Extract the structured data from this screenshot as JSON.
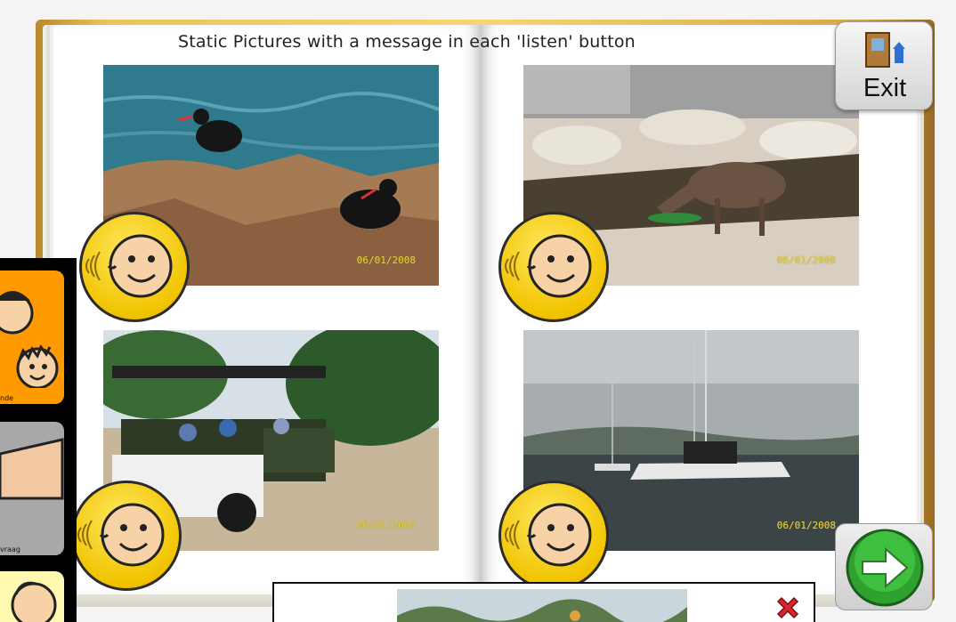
{
  "page": {
    "title": "Static Pictures with a message in each 'listen' button"
  },
  "photos": [
    {
      "name": "oystercatchers",
      "date": "06/01/2008"
    },
    {
      "name": "antelope",
      "date": "06/01/2008"
    },
    {
      "name": "safari-vehicle",
      "date": "06/01/2008"
    },
    {
      "name": "catamaran",
      "date": "06/01/2008"
    }
  ],
  "controls": {
    "exit_label": "Exit"
  },
  "side_panel": {
    "tiles": [
      {
        "label": "nde",
        "color": "#ff9a00"
      },
      {
        "label": "vraag",
        "color": "#a8a8a8"
      },
      {
        "label": "",
        "color": "#fffab0"
      }
    ]
  },
  "icons": {
    "listen": "speaking-face-icon",
    "exit": "door-exit-icon",
    "next": "green-arrow-right-icon",
    "close": "red-x-icon"
  },
  "colors": {
    "listen_button": "#f2c400",
    "next_button": "#2fa12f",
    "close": "#d8262c"
  }
}
